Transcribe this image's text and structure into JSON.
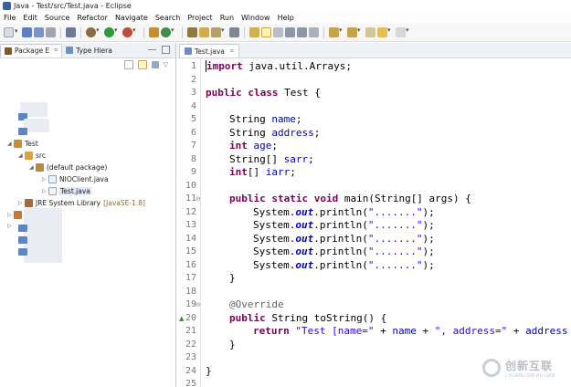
{
  "window": {
    "title": "Java - Test/src/Test.java - Eclipse"
  },
  "menu": [
    "File",
    "Edit",
    "Source",
    "Refactor",
    "Navigate",
    "Search",
    "Project",
    "Run",
    "Window",
    "Help"
  ],
  "left_panel": {
    "tabs": [
      {
        "label": "Package E",
        "close": "⌗"
      },
      {
        "label": "Type Hiera"
      }
    ],
    "tree": {
      "project": "Test",
      "src": "src",
      "package": "(default package)",
      "files": [
        "NIOClient.java",
        "Test.java"
      ],
      "jre": "JRE System Library",
      "jre_version": "[JavaSE-1.8]"
    }
  },
  "editor": {
    "tab_label": "Test.java",
    "tab_close": "⌗",
    "line_numbers": [
      "1",
      "2",
      "3",
      "4",
      "5",
      "6",
      "7",
      "8",
      "9",
      "10",
      "11",
      "12",
      "13",
      "14",
      "15",
      "16",
      "17",
      "18",
      "19",
      "20",
      "21",
      "22",
      "23",
      "24",
      "25"
    ],
    "code": {
      "l1_kw": "import",
      "l1_rest": " java.util.Arrays;",
      "l3_kw": "public class",
      "l3_rest": " Test {",
      "l5_type": "String",
      "l5_field": "name",
      "l6_type": "String",
      "l6_field": "address",
      "l7_type": "int",
      "l7_field": "age",
      "l8_type": "String[]",
      "l8_field": "sarr",
      "l9_type": "int",
      "l9_arr": "[] ",
      "l9_field": "iarr",
      "l11_kw": "public static void",
      "l11_rest": " main(String[] args) {",
      "sys": "System.",
      "out": "out",
      "println": ".println(",
      "dots": "\".......\"",
      "close_paren": ");",
      "brace_close": "}",
      "l19_ann": "@Override",
      "l20_kw": "public",
      "l20_rest": " String toString() {",
      "l21_kw": "return",
      "l21_str1": "\"Test [name=\"",
      "l21_plus": " + ",
      "l21_name": "name",
      "l21_str2": "\", address=\"",
      "l21_addr": "address"
    }
  },
  "watermark": {
    "text": "创新互联",
    "sub": "CHUANG XIN HU LIAN"
  }
}
